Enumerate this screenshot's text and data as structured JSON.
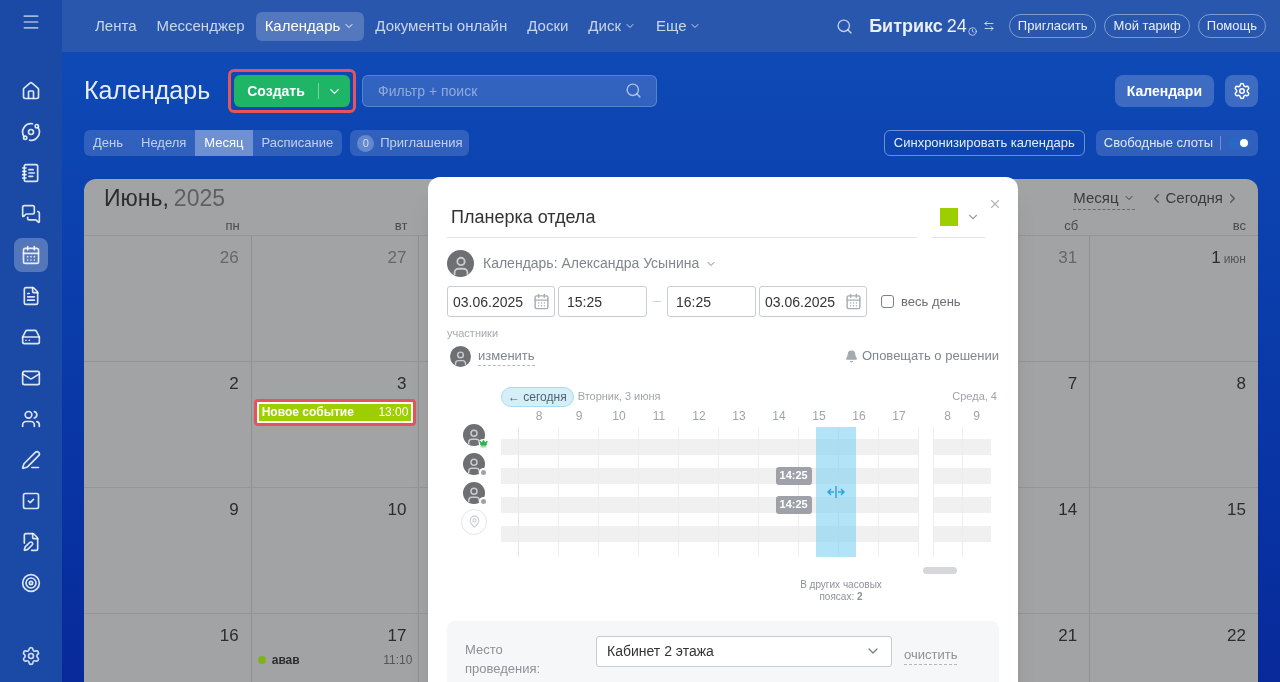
{
  "topbar": {
    "items": [
      {
        "label": "Лента",
        "selected": false,
        "dropdown": false
      },
      {
        "label": "Мессенджер",
        "selected": false,
        "dropdown": false
      },
      {
        "label": "Календарь",
        "selected": true,
        "dropdown": true
      },
      {
        "label": "Документы онлайн",
        "selected": false,
        "dropdown": false
      },
      {
        "label": "Доски",
        "selected": false,
        "dropdown": false
      },
      {
        "label": "Диск",
        "selected": false,
        "dropdown": true
      },
      {
        "label": "Еще",
        "selected": false,
        "dropdown": true
      }
    ],
    "brand": "Битрикс",
    "brand_suffix": "24",
    "buttons": [
      "Пригласить",
      "Мой тариф",
      "Помощь"
    ]
  },
  "sidebar": {
    "items": [
      {
        "selected": false
      },
      {
        "selected": false
      },
      {
        "selected": false
      },
      {
        "selected": false
      },
      {
        "selected": true
      },
      {
        "selected": false
      },
      {
        "selected": false
      },
      {
        "selected": false
      },
      {
        "selected": false
      },
      {
        "selected": false
      },
      {
        "selected": false
      },
      {
        "selected": false
      },
      {
        "selected": false
      }
    ]
  },
  "header": {
    "title": "Календарь",
    "create_button": {
      "label": "Создать",
      "highlighted": true
    },
    "search": {
      "placeholder": "Фильтр + поиск"
    },
    "calendars_button": "Календари"
  },
  "view_tabs": [
    {
      "label": "День",
      "selected": false
    },
    {
      "label": "Неделя",
      "selected": false
    },
    {
      "label": "Месяц",
      "selected": true
    },
    {
      "label": "Расписание",
      "selected": false
    }
  ],
  "invitations": {
    "count": "0",
    "label": "Приглашения"
  },
  "sync_button": "Синхронизировать календарь",
  "free_slots": {
    "label": "Свободные слоты",
    "on": true
  },
  "calendar": {
    "month": "Июнь,",
    "year": "2025",
    "view_switch": "Месяц",
    "today_button": "Сегодня",
    "weekdays_left": [
      "пн",
      "вт"
    ],
    "weekdays_right": [
      "сб",
      "вс"
    ],
    "weeks": [
      {
        "left": [
          {
            "day": "26",
            "other_month": true
          },
          {
            "day": "27",
            "other_month": true
          }
        ],
        "right": [
          {
            "day": "31",
            "other_month": true
          },
          {
            "day": "1",
            "month_label": "июн",
            "other_month": false
          }
        ]
      },
      {
        "left": [
          {
            "day": "2",
            "other_month": false
          },
          {
            "day": "3",
            "other_month": false,
            "events": [
              {
                "kind": "bar",
                "title": "Новое событие",
                "time": "13:00",
                "color": "#9dcf00",
                "highlighted": true
              }
            ]
          }
        ],
        "right": [
          {
            "day": "7",
            "other_month": false
          },
          {
            "day": "8",
            "other_month": false
          }
        ]
      },
      {
        "left": [
          {
            "day": "9",
            "other_month": false
          },
          {
            "day": "10",
            "other_month": false
          }
        ],
        "right": [
          {
            "day": "14",
            "other_month": false
          },
          {
            "day": "15",
            "other_month": false
          }
        ]
      },
      {
        "left": [
          {
            "day": "16",
            "other_month": false
          },
          {
            "day": "17",
            "other_month": false,
            "events": [
              {
                "kind": "dot",
                "title": "авав",
                "time": "11:10",
                "color": "#7fb21c"
              }
            ]
          }
        ],
        "right": [
          {
            "day": "21",
            "other_month": false
          },
          {
            "day": "22",
            "other_month": false
          }
        ]
      }
    ]
  },
  "event_form": {
    "title": "Планерка отдела",
    "color": "#9dcf00",
    "calendar_label": "Календарь: Александра Усынина",
    "start_date": "03.06.2025",
    "start_time": "15:25",
    "end_time": "16:25",
    "end_date": "03.06.2025",
    "all_day": {
      "label": "весь день",
      "checked": false
    },
    "attendees_label": "участники",
    "change_link": "изменить",
    "notify": "Оповещать о решении",
    "planner": {
      "today_button": "← сегодня",
      "day_label": "Вторник, 3 июня",
      "next_day_label": "Среда, 4",
      "hours": [
        "8",
        "9",
        "10",
        "11",
        "12",
        "13",
        "14",
        "15",
        "16",
        "17"
      ],
      "next_hours": [
        "8",
        "9"
      ],
      "rows": [
        {
          "kind": "organizer"
        },
        {
          "kind": "participant",
          "busy_label": "14:25"
        },
        {
          "kind": "participant",
          "busy_label": "14:25"
        },
        {
          "kind": "location"
        }
      ],
      "timezone_note": "В других часовых поясах: **2**"
    },
    "location": {
      "label": "Место проведения:",
      "value": "Кабинет 2 этажа",
      "clear_link": "очистить"
    }
  }
}
